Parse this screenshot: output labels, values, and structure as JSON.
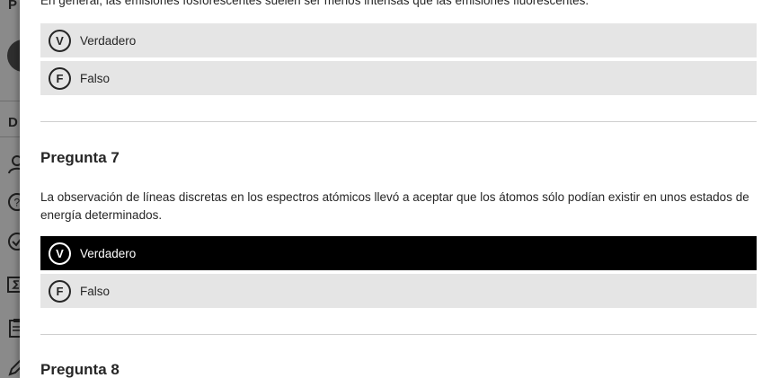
{
  "sidebar": {
    "top_letter": "P",
    "section_letter": "D",
    "icons": [
      "user-icon",
      "help-circle-icon",
      "check-circle-icon",
      "sigma-icon",
      "clipboard-icon",
      "pencil-icon"
    ]
  },
  "previous_question": {
    "text": "En general, las emisiones fosforescentes suelen ser menos intensas que las emisiones fluorescentes.",
    "options": [
      {
        "badge": "V",
        "label": "Verdadero",
        "selected": false
      },
      {
        "badge": "F",
        "label": "Falso",
        "selected": false
      }
    ]
  },
  "question_7": {
    "title": "Pregunta 7",
    "text": "La observación de líneas discretas en los espectros atómicos llevó a aceptar que los átomos sólo podían existir en unos estados de energía determinados.",
    "options": [
      {
        "badge": "V",
        "label": "Verdadero",
        "selected": true
      },
      {
        "badge": "F",
        "label": "Falso",
        "selected": false
      }
    ]
  },
  "question_8": {
    "title": "Pregunta 8"
  },
  "colors": {
    "option_bg": "#e5e5e5",
    "selected_bg": "#000000",
    "selected_text": "#ffffff",
    "text": "#262626",
    "divider": "#cfcfcf",
    "sidebar_dim": "#8a8a8a"
  }
}
